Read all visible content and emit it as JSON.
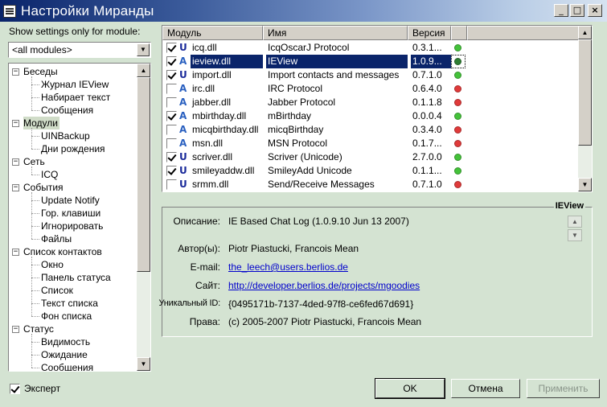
{
  "window": {
    "title": "Настройки Миранды",
    "minimize_label": "_",
    "maximize_label": "□",
    "close_label": "×"
  },
  "left": {
    "filter_label": "Show settings only for module:",
    "filter_value": "<all modules>",
    "tree": [
      {
        "label": "Беседы",
        "level": 0,
        "expanded": true
      },
      {
        "label": "Журнал IEView",
        "level": 1
      },
      {
        "label": "Набирает текст",
        "level": 1
      },
      {
        "label": "Сообщения",
        "level": 1
      },
      {
        "label": "Модули",
        "level": 0,
        "expanded": true,
        "selected": true
      },
      {
        "label": "UINBackup",
        "level": 1
      },
      {
        "label": "Дни рождения",
        "level": 1
      },
      {
        "label": "Сеть",
        "level": 0,
        "expanded": true
      },
      {
        "label": "ICQ",
        "level": 1
      },
      {
        "label": "События",
        "level": 0,
        "expanded": true
      },
      {
        "label": "Update Notify",
        "level": 1
      },
      {
        "label": "Гор. клавиши",
        "level": 1
      },
      {
        "label": "Игнорировать",
        "level": 1
      },
      {
        "label": "Файлы",
        "level": 1
      },
      {
        "label": "Список контактов",
        "level": 0,
        "expanded": true
      },
      {
        "label": "Окно",
        "level": 1
      },
      {
        "label": "Панель статуса",
        "level": 1
      },
      {
        "label": "Список",
        "level": 1
      },
      {
        "label": "Текст списка",
        "level": 1
      },
      {
        "label": "Фон списка",
        "level": 1
      },
      {
        "label": "Статус",
        "level": 0,
        "expanded": true
      },
      {
        "label": "Видимость",
        "level": 1
      },
      {
        "label": "Ожидание",
        "level": 1
      },
      {
        "label": "Сообщения",
        "level": 1
      }
    ],
    "expert_label": "Эксперт",
    "expert_checked": true
  },
  "modules": {
    "columns": [
      "Модуль",
      "Имя",
      "Версия"
    ],
    "rows": [
      {
        "checked": true,
        "icon": "U",
        "file": "icq.dll",
        "name": "IcqOscarJ Protocol",
        "version": "0.3.1...",
        "status": "green"
      },
      {
        "checked": true,
        "icon": "A",
        "file": "ieview.dll",
        "name": "IEView",
        "version": "1.0.9...",
        "status": "green",
        "selected": true
      },
      {
        "checked": true,
        "icon": "U",
        "file": "import.dll",
        "name": "Import contacts and messages",
        "version": "0.7.1.0",
        "status": "green"
      },
      {
        "checked": false,
        "icon": "A",
        "file": "irc.dll",
        "name": "IRC Protocol",
        "version": "0.6.4.0",
        "status": "red"
      },
      {
        "checked": false,
        "icon": "A",
        "file": "jabber.dll",
        "name": "Jabber Protocol",
        "version": "0.1.1.8",
        "status": "red"
      },
      {
        "checked": true,
        "icon": "A",
        "file": "mbirthday.dll",
        "name": "mBirthday",
        "version": "0.0.0.4",
        "status": "green"
      },
      {
        "checked": false,
        "icon": "A",
        "file": "micqbirthday.dll",
        "name": "micqBirthday",
        "version": "0.3.4.0",
        "status": "red"
      },
      {
        "checked": false,
        "icon": "A",
        "file": "msn.dll",
        "name": "MSN Protocol",
        "version": "0.1.7...",
        "status": "red"
      },
      {
        "checked": true,
        "icon": "U",
        "file": "scriver.dll",
        "name": "Scriver (Unicode)",
        "version": "2.7.0.0",
        "status": "green"
      },
      {
        "checked": true,
        "icon": "U",
        "file": "smileyaddw.dll",
        "name": "SmileyAdd Unicode",
        "version": "0.1.1...",
        "status": "green"
      },
      {
        "checked": false,
        "icon": "U",
        "file": "srmm.dll",
        "name": "Send/Receive Messages",
        "version": "0.7.1.0",
        "status": "red"
      }
    ],
    "status_colors": {
      "green": "#44c23a",
      "red": "#e03a3a",
      "selected_green": "#2e7d32"
    }
  },
  "info": {
    "group_title": "IEView",
    "description_label": "Описание:",
    "description": "IE Based Chat Log (1.0.9.10 Jun 13 2007)",
    "authors_label": "Автор(ы):",
    "authors": "Piotr Piastucki, Francois Mean",
    "email_label": "E-mail:",
    "email": "the_leech@users.berlios.de",
    "site_label": "Сайт:",
    "site": "http://developer.berlios.de/projects/mgoodies",
    "uid_label": "Уникальный ID:",
    "uid": "{0495171b-7137-4ded-97f8-ce6fed67d691}",
    "rights_label": "Права:",
    "rights": "(c) 2005-2007 Piotr Piastucki, Francois Mean"
  },
  "buttons": {
    "ok": "OK",
    "cancel": "Отмена",
    "apply": "Применить"
  }
}
